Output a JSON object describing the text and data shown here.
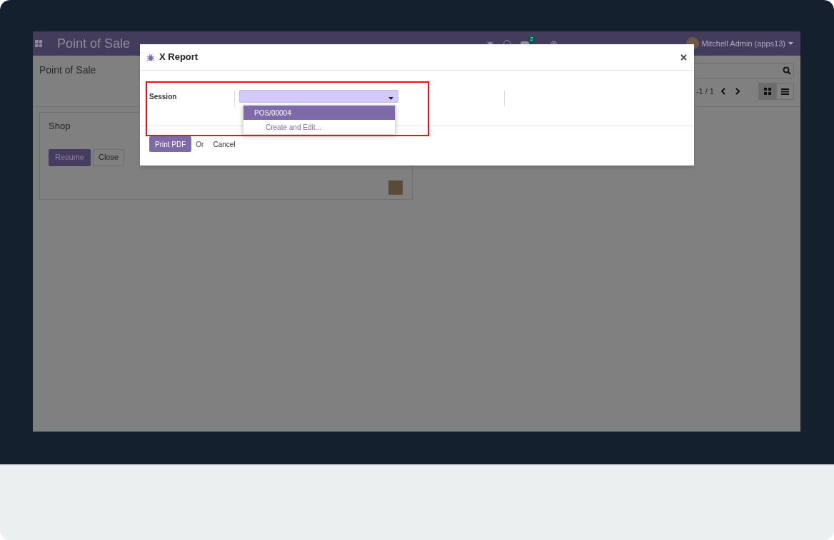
{
  "navbar": {
    "app_title": "Point of Sale",
    "chat_count": "2",
    "user": "Mitchell Admin (apps13)"
  },
  "control_panel": {
    "breadcrumb": "Point of Sale",
    "pager": "-1 / 1",
    "views": [
      {
        "kind": "kanban",
        "selected": true
      },
      {
        "kind": "list",
        "selected": false
      }
    ]
  },
  "kanban_card": {
    "title": "Shop",
    "buttons": [
      "Resume",
      "Close"
    ]
  },
  "dialog": {
    "title": "X Report",
    "field_label": "Session",
    "dropdown": [
      {
        "kind": "option",
        "label": "POS/00004",
        "selected": true
      },
      {
        "kind": "action",
        "label": "Create and Edit...",
        "selected": false
      }
    ],
    "footer": {
      "primary": "Print PDF",
      "separator": "Or",
      "cancel": "Cancel"
    }
  }
}
